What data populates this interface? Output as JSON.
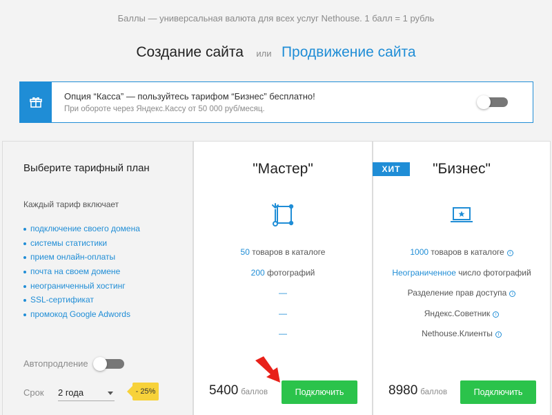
{
  "tagline": "Баллы — универсальная валюта для всех услуг Nethouse. 1 балл = 1 рубль",
  "switcher": {
    "site_label": "Создание сайта",
    "or_label": "или",
    "promo_label": "Продвижение сайта"
  },
  "banner": {
    "icon": "gift-icon",
    "title": "Опция “Касса” — пользуйтесь тарифом “Бизнес” бесплатно!",
    "subtitle": "При обороте через Яндекс.Кассу от 50 000 руб/месяц.",
    "toggle_on": false
  },
  "left": {
    "title": "Выберите тарифный план",
    "includes_label": "Каждый тариф включает",
    "features": [
      "подключение своего домена",
      "системы статистики",
      "прием онлайн-оплаты",
      "почта на своем домене",
      "неограниченный хостинг",
      "SSL-сертификат",
      "промокод Google Adwords"
    ],
    "autorenew_label": "Автопродление",
    "autorenew_on": false,
    "term_label": "Срок",
    "term_value": "2 года",
    "discount": "- 25%"
  },
  "plans": {
    "master": {
      "name": "\"Мастер\"",
      "icon": "tools-icon",
      "rows": [
        {
          "hl": "50",
          "text": " товаров в каталоге"
        },
        {
          "hl": "200",
          "text": " фотографий"
        },
        {
          "dash": "—"
        },
        {
          "dash": "—"
        },
        {
          "dash": "—"
        }
      ],
      "price": "5400",
      "unit": "баллов",
      "button": "Подключить"
    },
    "business": {
      "badge": "ХИТ",
      "name": "\"Бизнес\"",
      "icon": "laptop-star-icon",
      "rows": [
        {
          "hl": "1000",
          "text": " товаров в каталоге"
        },
        {
          "hl": "Неограниченное",
          "text": " число фотографий"
        },
        {
          "text": "Разделение прав доступа"
        },
        {
          "text": "Яндекс.Советник"
        },
        {
          "text": "Nethouse.Клиенты"
        }
      ],
      "info_glyph": "i",
      "price": "8980",
      "unit": "баллов",
      "button": "Подключить"
    }
  },
  "colors": {
    "accent": "#1f8dd6",
    "button": "#2bc34b",
    "badge_discount": "#f7d23a",
    "arrow": "#e8211a"
  }
}
